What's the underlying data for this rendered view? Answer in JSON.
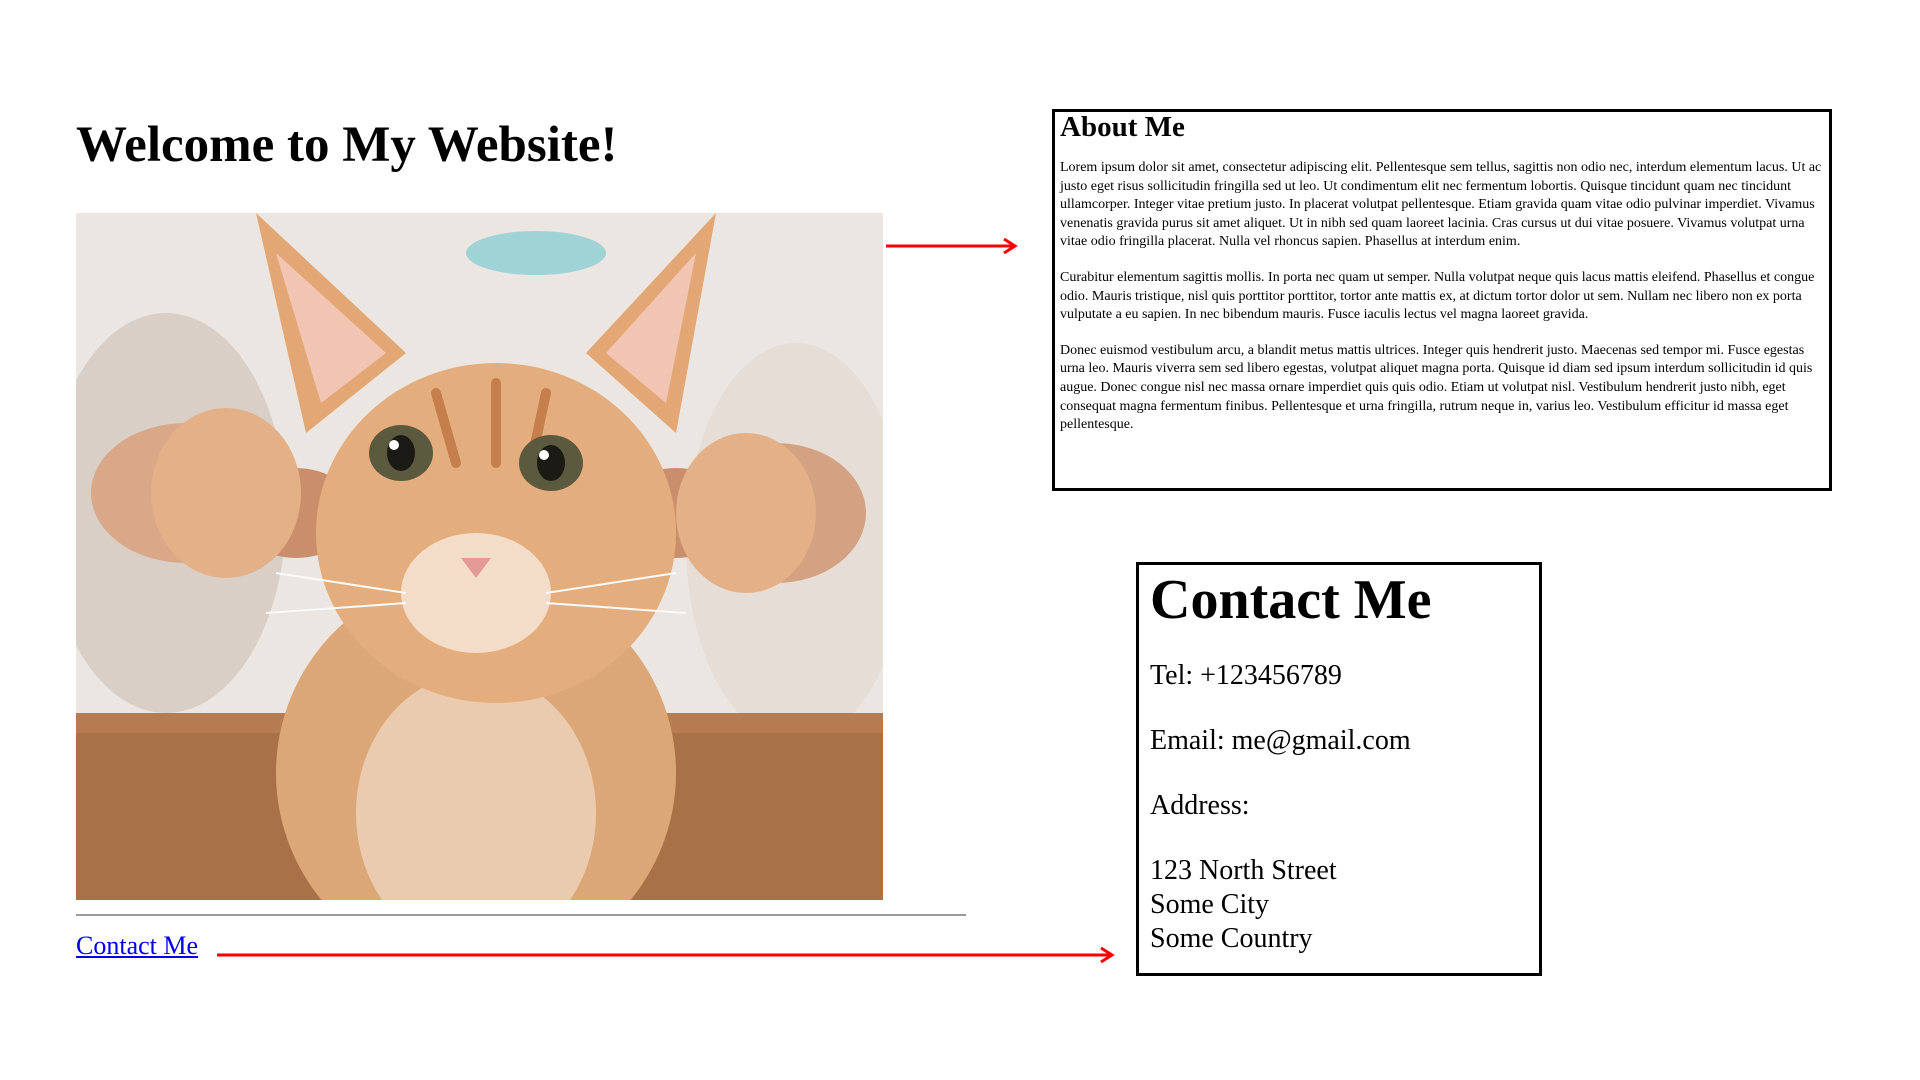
{
  "header": {
    "title": "Welcome to My Website!"
  },
  "nav": {
    "contact_link": "Contact Me"
  },
  "image": {
    "subject": "kitten-photo"
  },
  "about": {
    "title": "About Me",
    "paragraphs": [
      "Lorem ipsum dolor sit amet, consectetur adipiscing elit. Pellentesque sem tellus, sagittis non odio nec, interdum elementum lacus. Ut ac justo eget risus sollicitudin fringilla sed ut leo. Ut condimentum elit nec fermentum lobortis. Quisque tincidunt quam nec tincidunt ullamcorper. Integer vitae pretium justo. In placerat volutpat pellentesque. Etiam gravida quam vitae odio pulvinar imperdiet. Vivamus venenatis gravida purus sit amet aliquet. Ut in nibh sed quam laoreet lacinia. Cras cursus ut dui vitae posuere. Vivamus volutpat urna vitae odio fringilla placerat. Nulla vel rhoncus sapien. Phasellus at interdum enim.",
      "Curabitur elementum sagittis mollis. In porta nec quam ut semper. Nulla volutpat neque quis lacus mattis eleifend. Phasellus et congue odio. Mauris tristique, nisl quis porttitor porttitor, tortor ante mattis ex, at dictum tortor dolor ut sem. Nullam nec libero non ex porta vulputate a eu sapien. In nec bibendum mauris. Fusce iaculis lectus vel magna laoreet gravida.",
      "Donec euismod vestibulum arcu, a blandit metus mattis ultrices. Integer quis hendrerit justo. Maecenas sed tempor mi. Fusce egestas urna leo. Mauris viverra sem sed libero egestas, volutpat aliquet magna porta. Quisque id diam sed ipsum interdum sollicitudin id quis augue. Donec congue nisl nec massa ornare imperdiet quis quis odio. Etiam ut volutpat nisl. Vestibulum hendrerit justo nibh, eget consequat magna fermentum finibus. Pellentesque et urna fringilla, rutrum neque in, varius leo. Vestibulum efficitur id massa eget pellentesque."
    ]
  },
  "contact": {
    "title": "Contact Me",
    "tel": "Tel: +123456789",
    "email": "Email: me@gmail.com",
    "address_label": "Address:",
    "address_lines": [
      "123 North Street",
      "Some City",
      "Some Country"
    ]
  },
  "colors": {
    "arrow": "#ff0000",
    "link": "#0000ee",
    "border": "#000000",
    "divider": "#9a9a9a"
  }
}
